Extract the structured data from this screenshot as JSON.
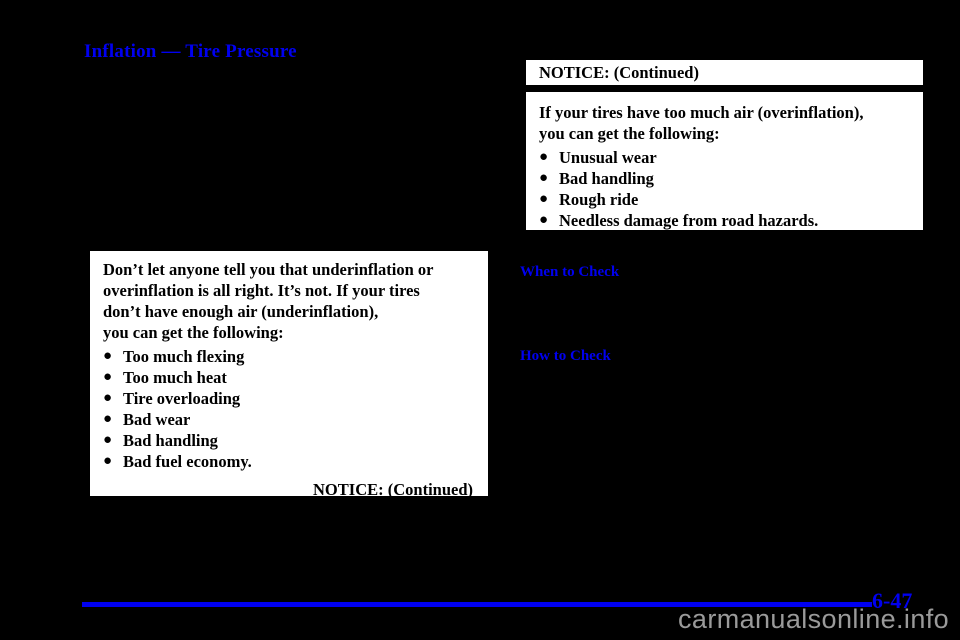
{
  "page": {
    "section_title": "Inflation — Tire Pressure",
    "page_number": "6-47",
    "watermark": "carmanualsonline.info",
    "accent_color": "#0000f0",
    "background_color": "#000000",
    "box_background_color": "#ffffff"
  },
  "left_notice": {
    "lines": [
      "Don’t let anyone tell you that underinflation or",
      "overinflation is all right. It’s not. If your tires",
      "don’t have enough air (underinflation),",
      "you can get the following:"
    ],
    "bullet_glyph": "●",
    "bullets": [
      "Too much flexing",
      "Too much heat",
      "Tire overloading",
      "Bad wear",
      "Bad handling",
      "Bad fuel economy."
    ],
    "continued_label": "NOTICE: (Continued)"
  },
  "right_notice": {
    "header": "NOTICE: (Continued)",
    "lines": [
      "If your tires have too much air (overinflation),",
      "you can get the following:"
    ],
    "bullet_glyph": "●",
    "bullets": [
      "Unusual wear",
      "Bad handling",
      "Rough ride",
      "Needless damage from road hazards."
    ]
  },
  "subheadings": {
    "when_to_check": "When to Check",
    "how_to_check": "How to Check"
  }
}
